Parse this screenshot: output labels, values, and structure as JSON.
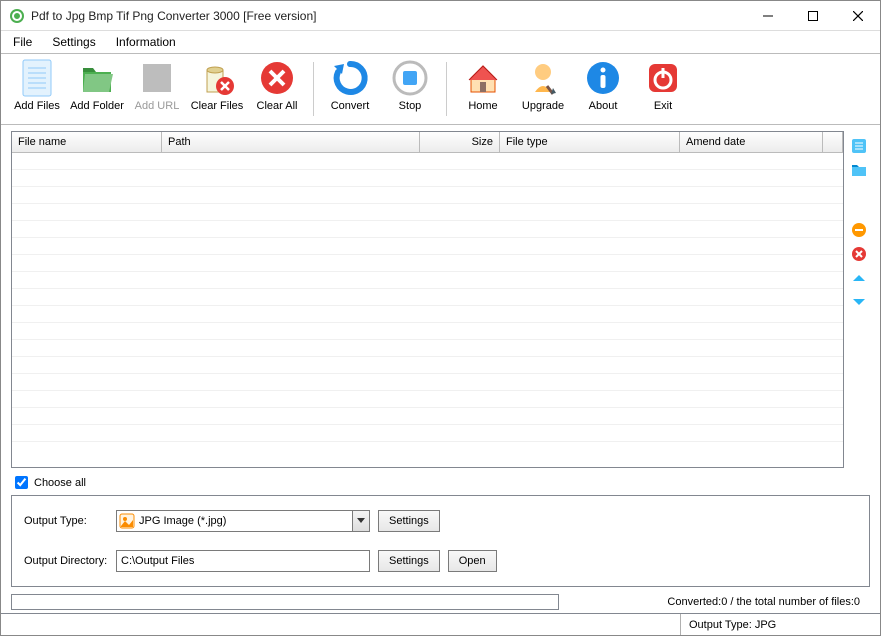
{
  "title": "Pdf to Jpg Bmp Tif Png Converter 3000 [Free version]",
  "menu": {
    "file": "File",
    "settings": "Settings",
    "info": "Information"
  },
  "toolbar": {
    "add_files": "Add Files",
    "add_folder": "Add Folder",
    "add_url": "Add URL",
    "clear_files": "Clear Files",
    "clear_all": "Clear All",
    "convert": "Convert",
    "stop": "Stop",
    "home": "Home",
    "upgrade": "Upgrade",
    "about": "About",
    "exit": "Exit"
  },
  "columns": {
    "file_name": "File name",
    "path": "Path",
    "size": "Size",
    "file_type": "File type",
    "amend_date": "Amend date"
  },
  "choose_all": "Choose all",
  "output": {
    "type_label": "Output Type:",
    "type_value": "JPG Image (*.jpg)",
    "dir_label": "Output Directory:",
    "dir_value": "C:\\Output Files",
    "settings_btn": "Settings",
    "open_btn": "Open"
  },
  "progress": {
    "text": "Converted:0  /  the total number of files:0"
  },
  "status": {
    "output_type": "Output Type: JPG"
  }
}
